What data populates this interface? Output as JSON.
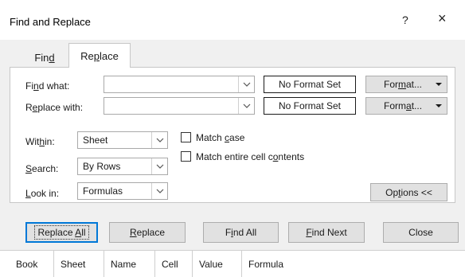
{
  "dialog": {
    "title": "Find and Replace",
    "help_label": "?",
    "close_label": "×"
  },
  "tabs": [
    {
      "label_pre": "Fin",
      "label_key": "d",
      "label_post": ""
    },
    {
      "label_pre": "Re",
      "label_key": "p",
      "label_post": "lace"
    }
  ],
  "find": {
    "label_pre": "Fi",
    "label_key": "n",
    "label_post": "d what:",
    "value": "",
    "format_status": "No Format Set",
    "format_btn_pre": "For",
    "format_btn_key": "m",
    "format_btn_post": "at..."
  },
  "replace": {
    "label_pre": "R",
    "label_key": "e",
    "label_post": "place with:",
    "value": "",
    "format_status": "No Format Set",
    "format_btn_pre": "Form",
    "format_btn_key": "a",
    "format_btn_post": "t..."
  },
  "options": {
    "within": {
      "label_pre": "Wit",
      "label_key": "h",
      "label_post": "in:",
      "value": "Sheet"
    },
    "search": {
      "label_pre": "",
      "label_key": "S",
      "label_post": "earch:",
      "value": "By Rows"
    },
    "lookin": {
      "label_pre": "",
      "label_key": "L",
      "label_post": "ook in:",
      "value": "Formulas"
    },
    "match_case": {
      "label_pre": "Match ",
      "label_key": "c",
      "label_post": "ase",
      "checked": false
    },
    "match_entire": {
      "label_pre": "Match entire cell c",
      "label_key": "o",
      "label_post": "ntents",
      "checked": false
    },
    "options_btn": {
      "label_pre": "Op",
      "label_key": "t",
      "label_post": "ions <<"
    }
  },
  "buttons": {
    "replace_all": {
      "pre": "Replace ",
      "key": "A",
      "post": "ll"
    },
    "replace": {
      "pre": "",
      "key": "R",
      "post": "eplace"
    },
    "find_all": {
      "pre": "F",
      "key": "i",
      "post": "nd All"
    },
    "find_next": {
      "pre": "",
      "key": "F",
      "post": "ind Next"
    },
    "close": {
      "pre": "Close",
      "key": "",
      "post": ""
    }
  },
  "results_columns": [
    "Book",
    "Sheet",
    "Name",
    "Cell",
    "Value",
    "Formula"
  ],
  "colors": {
    "accent": "#0078d7",
    "background": "#f0f0f0"
  }
}
